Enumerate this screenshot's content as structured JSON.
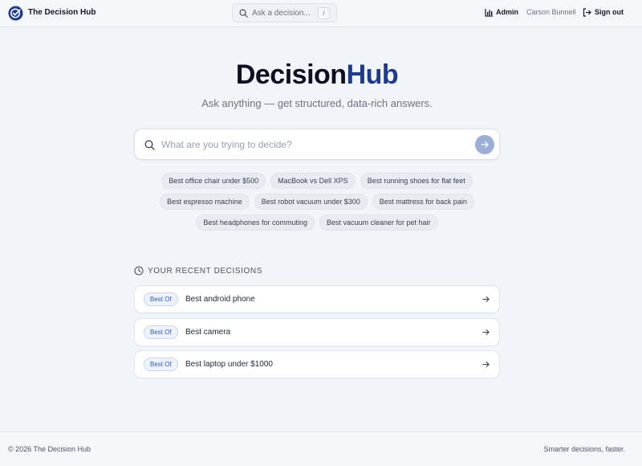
{
  "header": {
    "brand": "The Decision Hub",
    "search_placeholder": "Ask a decision...",
    "search_shortcut": "/",
    "admin_label": "Admin",
    "user_name": "Carson Bunnell",
    "signout_label": "Sign out"
  },
  "hero": {
    "title_part1": "Decision",
    "title_part2": "Hub",
    "tagline": "Ask anything — get structured, data-rich answers.",
    "search_placeholder": "What are you trying to decide?"
  },
  "suggestions": [
    [
      "Best office chair under $500",
      "MacBook vs Dell XPS",
      "Best running shoes for flat feet"
    ],
    [
      "Best espresso machine",
      "Best robot vacuum under $300",
      "Best mattress for back pain"
    ],
    [
      "Best headphones for commuting",
      "Best vacuum cleaner for pet hair"
    ]
  ],
  "recent": {
    "heading": "YOUR RECENT DECISIONS",
    "items": [
      {
        "badge": "Best Of",
        "label": "Best android phone"
      },
      {
        "badge": "Best Of",
        "label": "Best camera"
      },
      {
        "badge": "Best Of",
        "label": "Best laptop under $1000"
      }
    ]
  },
  "footer": {
    "copyright": "© 2026 The Decision Hub",
    "slogan": "Smarter decisions, faster."
  },
  "colors": {
    "brand_navy": "#1e3a8a",
    "background": "#f1f4f9",
    "submit_button": "#9aaed8",
    "badge_text": "#2b5bb6"
  },
  "icons": [
    "logo-check-icon",
    "search-icon",
    "bar-chart-icon",
    "sign-out-icon",
    "arrow-right-icon",
    "clock-icon"
  ]
}
